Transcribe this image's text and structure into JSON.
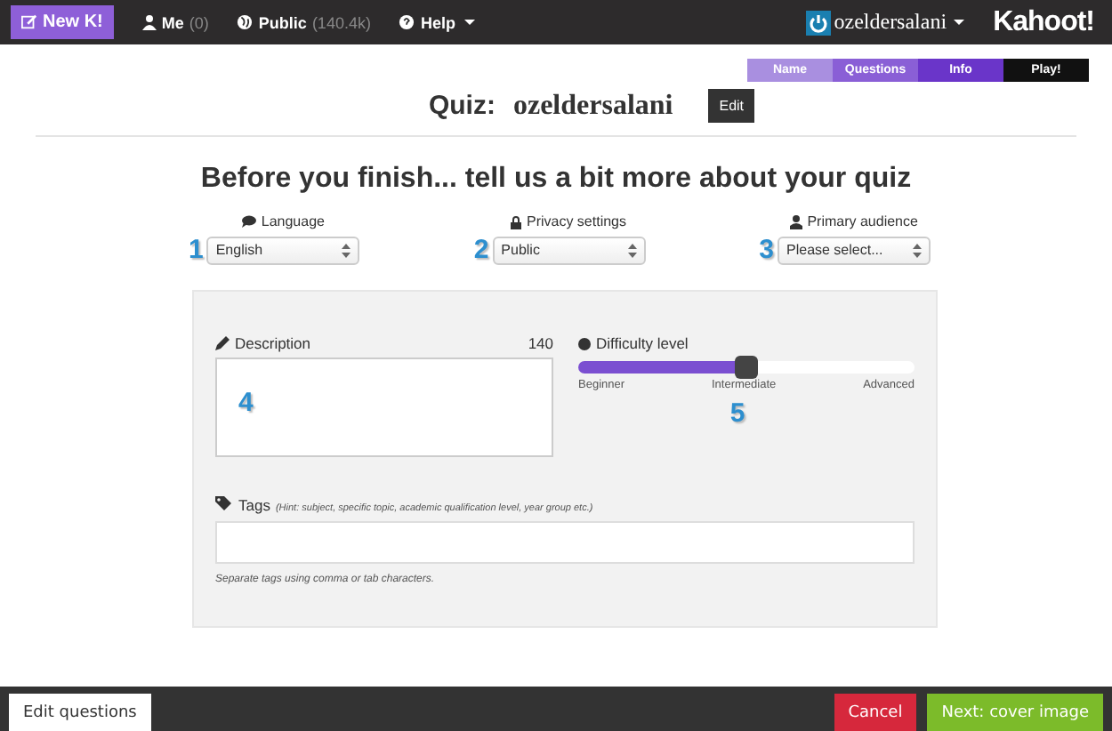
{
  "top_bar": {
    "new_button": "New K!",
    "nav": [
      {
        "label": "Me",
        "count": "(0)"
      },
      {
        "label": "Public",
        "count": "(140.4k)"
      },
      {
        "label": "Help"
      }
    ],
    "user": "ozeldersalani",
    "logo": "Kahoot!"
  },
  "steps": [
    {
      "label": "Name",
      "color": "#a98fe0"
    },
    {
      "label": "Questions",
      "color": "#8a5fd6"
    },
    {
      "label": "Info",
      "color": "#6a35c9"
    },
    {
      "label": "Play!",
      "color": "#111111"
    }
  ],
  "quiz": {
    "label": "Quiz:",
    "name": "ozeldersalani",
    "edit": "Edit"
  },
  "heading": "Before you finish... tell us a bit more about your quiz",
  "selects": [
    {
      "callout": "1",
      "label": "Language",
      "value": "English"
    },
    {
      "callout": "2",
      "label": "Privacy settings",
      "value": "Public"
    },
    {
      "callout": "3",
      "label": "Primary audience",
      "value": "Please select..."
    }
  ],
  "description": {
    "label": "Description",
    "count": "140",
    "callout": "4"
  },
  "difficulty": {
    "label": "Difficulty level",
    "level": 0.5,
    "ticks": [
      "Beginner",
      "Intermediate",
      "Advanced"
    ],
    "callout": "5"
  },
  "tags": {
    "label": "Tags",
    "hint": "(Hint: subject, specific topic, academic qualification level, year group etc.)",
    "help": "Separate tags using comma or tab characters."
  },
  "bottom_bar": {
    "edit_questions": "Edit questions",
    "cancel": "Cancel",
    "next": "Next: cover image"
  }
}
